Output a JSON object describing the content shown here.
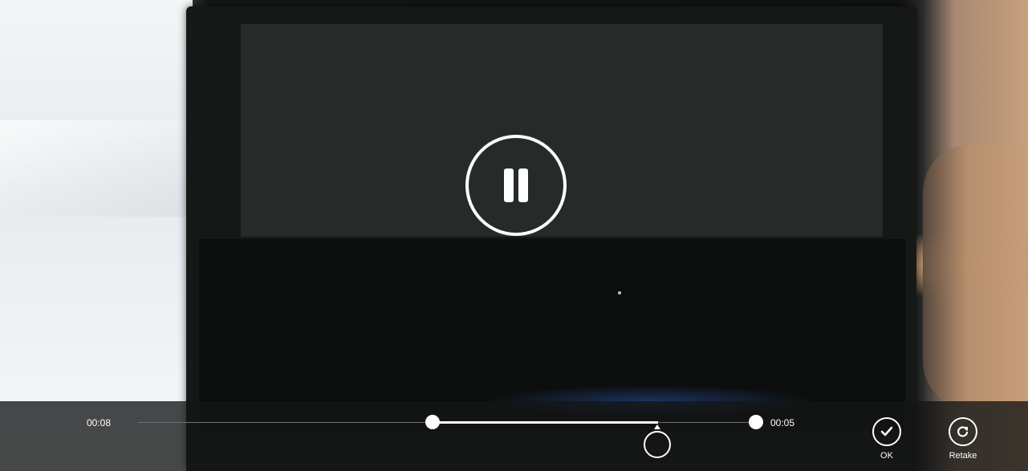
{
  "video": {
    "state": "playing"
  },
  "controls": {
    "pause_icon": "pause-icon",
    "trim": {
      "start_time": "00:08",
      "end_time": "00:05",
      "playhead_position": 0.76
    },
    "actions": {
      "ok_label": "OK",
      "retake_label": "Retake"
    },
    "icons": {
      "ok": "checkmark-icon",
      "retake": "retake-icon"
    }
  },
  "colors": {
    "control_bar_bg": "#141616",
    "foreground": "#ffffff",
    "track_unselected": "#6d6f70"
  }
}
